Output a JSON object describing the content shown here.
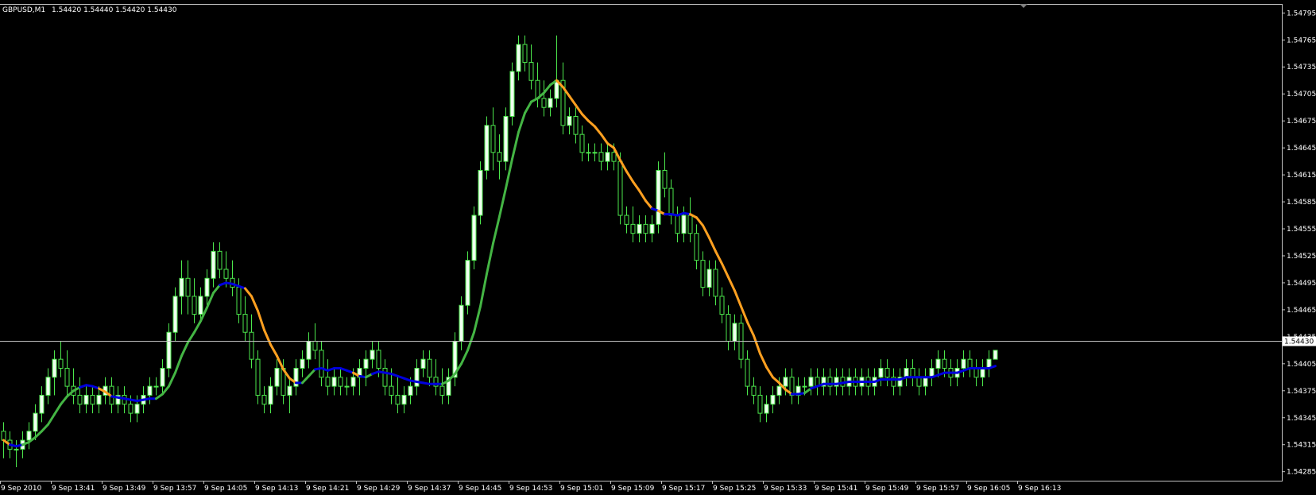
{
  "header": {
    "symbol": "GBPUSD,M1",
    "quote": "1.54420 1.54440 1.54420 1.54430"
  },
  "current_price_label": "1.54430",
  "colors": {
    "background": "#000000",
    "axis": "#c0c0c0",
    "text": "#ffffff",
    "bull_candle_body": "#f0fff0",
    "candle_wick": "#4ce74c",
    "ma_up": "#44b544",
    "ma_flat": "#0000dd",
    "ma_down": "#ffa020",
    "current_price_line": "#c0c0c0"
  },
  "chart_data": {
    "type": "candlestick",
    "title": "",
    "xlabel": "",
    "ylabel": "",
    "ylim": [
      1.54275,
      1.54805
    ],
    "price_ticks": [
      "1.54795",
      "1.54765",
      "1.54735",
      "1.54705",
      "1.54675",
      "1.54645",
      "1.54615",
      "1.54585",
      "1.54555",
      "1.54525",
      "1.54495",
      "1.54465",
      "1.54435",
      "1.54405",
      "1.54375",
      "1.54345",
      "1.54315",
      "1.54285"
    ],
    "time_labels": [
      "9 Sep 2010",
      "9 Sep 13:41",
      "9 Sep 13:49",
      "9 Sep 13:57",
      "9 Sep 14:05",
      "9 Sep 14:13",
      "9 Sep 14:21",
      "9 Sep 14:29",
      "9 Sep 14:37",
      "9 Sep 14:45",
      "9 Sep 14:53",
      "9 Sep 15:01",
      "9 Sep 15:09",
      "9 Sep 15:17",
      "9 Sep 15:25",
      "9 Sep 15:33",
      "9 Sep 15:41",
      "9 Sep 15:49",
      "9 Sep 15:57",
      "9 Sep 16:05",
      "9 Sep 16:13"
    ],
    "current_price": 1.5443,
    "candles": [
      [
        1.5433,
        1.5434,
        1.543,
        1.5432
      ],
      [
        1.5432,
        1.5433,
        1.543,
        1.5431
      ],
      [
        1.5431,
        1.5432,
        1.5429,
        1.5431
      ],
      [
        1.5431,
        1.5433,
        1.543,
        1.5432
      ],
      [
        1.5432,
        1.5434,
        1.5431,
        1.5433
      ],
      [
        1.5433,
        1.5436,
        1.5432,
        1.5435
      ],
      [
        1.5435,
        1.5438,
        1.5434,
        1.5437
      ],
      [
        1.5437,
        1.544,
        1.5436,
        1.5439
      ],
      [
        1.5439,
        1.5442,
        1.5437,
        1.5441
      ],
      [
        1.5441,
        1.5443,
        1.5439,
        1.544
      ],
      [
        1.544,
        1.5442,
        1.5437,
        1.5438
      ],
      [
        1.5438,
        1.544,
        1.5436,
        1.5437
      ],
      [
        1.5437,
        1.5439,
        1.5435,
        1.5436
      ],
      [
        1.5436,
        1.5438,
        1.5435,
        1.5437
      ],
      [
        1.5437,
        1.5438,
        1.5435,
        1.5436
      ],
      [
        1.5436,
        1.5438,
        1.5435,
        1.5437
      ],
      [
        1.5437,
        1.5439,
        1.5436,
        1.5438
      ],
      [
        1.5438,
        1.5439,
        1.5435,
        1.5436
      ],
      [
        1.5436,
        1.5438,
        1.5435,
        1.5437
      ],
      [
        1.5437,
        1.5438,
        1.5435,
        1.5436
      ],
      [
        1.5436,
        1.5437,
        1.5434,
        1.5435
      ],
      [
        1.5435,
        1.5437,
        1.5434,
        1.5436
      ],
      [
        1.5436,
        1.5438,
        1.5435,
        1.5437
      ],
      [
        1.5437,
        1.5439,
        1.5436,
        1.5438
      ],
      [
        1.5438,
        1.5439,
        1.5437,
        1.5438
      ],
      [
        1.5438,
        1.5441,
        1.5437,
        1.544
      ],
      [
        1.544,
        1.5445,
        1.5439,
        1.5444
      ],
      [
        1.5444,
        1.5449,
        1.5443,
        1.5448
      ],
      [
        1.5448,
        1.5452,
        1.5446,
        1.545
      ],
      [
        1.545,
        1.5452,
        1.5446,
        1.5448
      ],
      [
        1.5448,
        1.545,
        1.5445,
        1.5446
      ],
      [
        1.5446,
        1.5449,
        1.5445,
        1.5448
      ],
      [
        1.5448,
        1.5451,
        1.5447,
        1.545
      ],
      [
        1.545,
        1.5454,
        1.5449,
        1.5453
      ],
      [
        1.5453,
        1.5454,
        1.545,
        1.5451
      ],
      [
        1.5451,
        1.5453,
        1.5449,
        1.545
      ],
      [
        1.545,
        1.5452,
        1.5448,
        1.5449
      ],
      [
        1.5449,
        1.545,
        1.5445,
        1.5446
      ],
      [
        1.5446,
        1.5448,
        1.5443,
        1.5444
      ],
      [
        1.5444,
        1.5446,
        1.544,
        1.5441
      ],
      [
        1.5441,
        1.5442,
        1.5436,
        1.5437
      ],
      [
        1.5437,
        1.5438,
        1.5435,
        1.5436
      ],
      [
        1.5436,
        1.5439,
        1.5435,
        1.5438
      ],
      [
        1.5438,
        1.5441,
        1.5437,
        1.544
      ],
      [
        1.544,
        1.5441,
        1.5436,
        1.5437
      ],
      [
        1.5437,
        1.5439,
        1.5435,
        1.5438
      ],
      [
        1.5438,
        1.5441,
        1.5437,
        1.544
      ],
      [
        1.544,
        1.5442,
        1.5439,
        1.5441
      ],
      [
        1.5441,
        1.5444,
        1.544,
        1.5443
      ],
      [
        1.5443,
        1.5445,
        1.5441,
        1.5442
      ],
      [
        1.5442,
        1.5443,
        1.5438,
        1.5439
      ],
      [
        1.5439,
        1.5441,
        1.5437,
        1.5438
      ],
      [
        1.5438,
        1.544,
        1.5437,
        1.5439
      ],
      [
        1.5439,
        1.544,
        1.5437,
        1.5438
      ],
      [
        1.5438,
        1.5439,
        1.5437,
        1.5438
      ],
      [
        1.5438,
        1.544,
        1.5437,
        1.5439
      ],
      [
        1.5439,
        1.5441,
        1.5437,
        1.544
      ],
      [
        1.544,
        1.5442,
        1.5438,
        1.5441
      ],
      [
        1.5441,
        1.5443,
        1.544,
        1.5442
      ],
      [
        1.5442,
        1.5443,
        1.5439,
        1.544
      ],
      [
        1.544,
        1.5441,
        1.5437,
        1.5438
      ],
      [
        1.5438,
        1.544,
        1.5436,
        1.5437
      ],
      [
        1.5437,
        1.5439,
        1.5435,
        1.5436
      ],
      [
        1.5436,
        1.5438,
        1.5435,
        1.5437
      ],
      [
        1.5437,
        1.5439,
        1.5436,
        1.5438
      ],
      [
        1.5438,
        1.5441,
        1.5437,
        1.544
      ],
      [
        1.544,
        1.5442,
        1.5439,
        1.5441
      ],
      [
        1.5441,
        1.5442,
        1.5438,
        1.5439
      ],
      [
        1.5439,
        1.5441,
        1.5437,
        1.5438
      ],
      [
        1.5438,
        1.544,
        1.5436,
        1.5437
      ],
      [
        1.5437,
        1.544,
        1.5436,
        1.5439
      ],
      [
        1.5439,
        1.5444,
        1.5438,
        1.5443
      ],
      [
        1.5443,
        1.5448,
        1.5442,
        1.5447
      ],
      [
        1.5447,
        1.5453,
        1.5446,
        1.5452
      ],
      [
        1.5452,
        1.5458,
        1.5451,
        1.5457
      ],
      [
        1.5457,
        1.5463,
        1.5456,
        1.5462
      ],
      [
        1.5462,
        1.5468,
        1.5461,
        1.5467
      ],
      [
        1.5467,
        1.5469,
        1.5462,
        1.5464
      ],
      [
        1.5464,
        1.5466,
        1.5461,
        1.5463
      ],
      [
        1.5463,
        1.5469,
        1.5462,
        1.5468
      ],
      [
        1.5468,
        1.5474,
        1.5467,
        1.5473
      ],
      [
        1.5473,
        1.5477,
        1.5472,
        1.5476
      ],
      [
        1.5476,
        1.5477,
        1.5473,
        1.5474
      ],
      [
        1.5474,
        1.5476,
        1.5471,
        1.5472
      ],
      [
        1.5472,
        1.5474,
        1.5469,
        1.547
      ],
      [
        1.547,
        1.5472,
        1.5468,
        1.5469
      ],
      [
        1.5469,
        1.5471,
        1.5468,
        1.547
      ],
      [
        1.547,
        1.5477,
        1.5469,
        1.5472
      ],
      [
        1.5472,
        1.5474,
        1.5466,
        1.5467
      ],
      [
        1.5467,
        1.5469,
        1.5466,
        1.5468
      ],
      [
        1.5468,
        1.5469,
        1.5465,
        1.5466
      ],
      [
        1.5466,
        1.5467,
        1.5463,
        1.5464
      ],
      [
        1.5464,
        1.5465,
        1.5463,
        1.5464
      ],
      [
        1.5464,
        1.5465,
        1.5463,
        1.5464
      ],
      [
        1.5464,
        1.5465,
        1.5462,
        1.5463
      ],
      [
        1.5463,
        1.5465,
        1.5462,
        1.5464
      ],
      [
        1.5464,
        1.5465,
        1.5462,
        1.5463
      ],
      [
        1.5463,
        1.5464,
        1.5456,
        1.5457
      ],
      [
        1.5457,
        1.5458,
        1.5455,
        1.5456
      ],
      [
        1.5456,
        1.5458,
        1.5454,
        1.5455
      ],
      [
        1.5455,
        1.5457,
        1.5454,
        1.5456
      ],
      [
        1.5456,
        1.5457,
        1.5454,
        1.5455
      ],
      [
        1.5455,
        1.5457,
        1.5454,
        1.5456
      ],
      [
        1.5456,
        1.5463,
        1.5455,
        1.5462
      ],
      [
        1.5462,
        1.5464,
        1.5459,
        1.546
      ],
      [
        1.546,
        1.5461,
        1.5456,
        1.5457
      ],
      [
        1.5457,
        1.5458,
        1.5454,
        1.5455
      ],
      [
        1.5455,
        1.5458,
        1.5454,
        1.5457
      ],
      [
        1.5457,
        1.5459,
        1.5454,
        1.5455
      ],
      [
        1.5455,
        1.5456,
        1.5451,
        1.5452
      ],
      [
        1.5452,
        1.5453,
        1.5448,
        1.5449
      ],
      [
        1.5449,
        1.5452,
        1.5448,
        1.5451
      ],
      [
        1.5451,
        1.5452,
        1.5447,
        1.5448
      ],
      [
        1.5448,
        1.5449,
        1.5445,
        1.5446
      ],
      [
        1.5446,
        1.5447,
        1.5442,
        1.5443
      ],
      [
        1.5443,
        1.5446,
        1.5442,
        1.5445
      ],
      [
        1.5445,
        1.5446,
        1.544,
        1.5441
      ],
      [
        1.5441,
        1.5442,
        1.5437,
        1.5438
      ],
      [
        1.5438,
        1.5439,
        1.5436,
        1.5437
      ],
      [
        1.5437,
        1.5438,
        1.5434,
        1.5435
      ],
      [
        1.5435,
        1.5437,
        1.5434,
        1.5436
      ],
      [
        1.5436,
        1.5438,
        1.5435,
        1.5437
      ],
      [
        1.5437,
        1.5439,
        1.5436,
        1.5438
      ],
      [
        1.5438,
        1.544,
        1.5437,
        1.5439
      ],
      [
        1.5439,
        1.544,
        1.5436,
        1.5437
      ],
      [
        1.5437,
        1.5439,
        1.5436,
        1.5438
      ],
      [
        1.5438,
        1.5439,
        1.5437,
        1.5438
      ],
      [
        1.5438,
        1.544,
        1.5437,
        1.5439
      ],
      [
        1.5439,
        1.544,
        1.5437,
        1.5438
      ],
      [
        1.5438,
        1.544,
        1.5437,
        1.5439
      ],
      [
        1.5439,
        1.544,
        1.5437,
        1.5438
      ],
      [
        1.5438,
        1.544,
        1.5437,
        1.5439
      ],
      [
        1.5439,
        1.544,
        1.5437,
        1.5438
      ],
      [
        1.5438,
        1.544,
        1.5437,
        1.5439
      ],
      [
        1.5439,
        1.544,
        1.5437,
        1.5438
      ],
      [
        1.5438,
        1.544,
        1.5437,
        1.5439
      ],
      [
        1.5439,
        1.544,
        1.5437,
        1.5438
      ],
      [
        1.5438,
        1.544,
        1.5437,
        1.5439
      ],
      [
        1.5439,
        1.5441,
        1.5438,
        1.544
      ],
      [
        1.544,
        1.5441,
        1.5438,
        1.5439
      ],
      [
        1.5439,
        1.544,
        1.5437,
        1.5438
      ],
      [
        1.5438,
        1.544,
        1.5437,
        1.5439
      ],
      [
        1.5439,
        1.5441,
        1.5438,
        1.544
      ],
      [
        1.544,
        1.5441,
        1.5438,
        1.5439
      ],
      [
        1.5439,
        1.544,
        1.5437,
        1.5438
      ],
      [
        1.5438,
        1.544,
        1.5437,
        1.5439
      ],
      [
        1.5439,
        1.5441,
        1.5438,
        1.544
      ],
      [
        1.544,
        1.5442,
        1.5439,
        1.5441
      ],
      [
        1.5441,
        1.5442,
        1.5439,
        1.544
      ],
      [
        1.544,
        1.5441,
        1.5438,
        1.5439
      ],
      [
        1.5439,
        1.5441,
        1.5438,
        1.544
      ],
      [
        1.544,
        1.5442,
        1.5439,
        1.5441
      ],
      [
        1.5441,
        1.5442,
        1.5439,
        1.544
      ],
      [
        1.544,
        1.5441,
        1.5438,
        1.5439
      ],
      [
        1.5439,
        1.5441,
        1.5438,
        1.544
      ],
      [
        1.544,
        1.5442,
        1.5439,
        1.5441
      ],
      [
        1.5441,
        1.5442,
        1.5442,
        1.5442
      ]
    ]
  }
}
